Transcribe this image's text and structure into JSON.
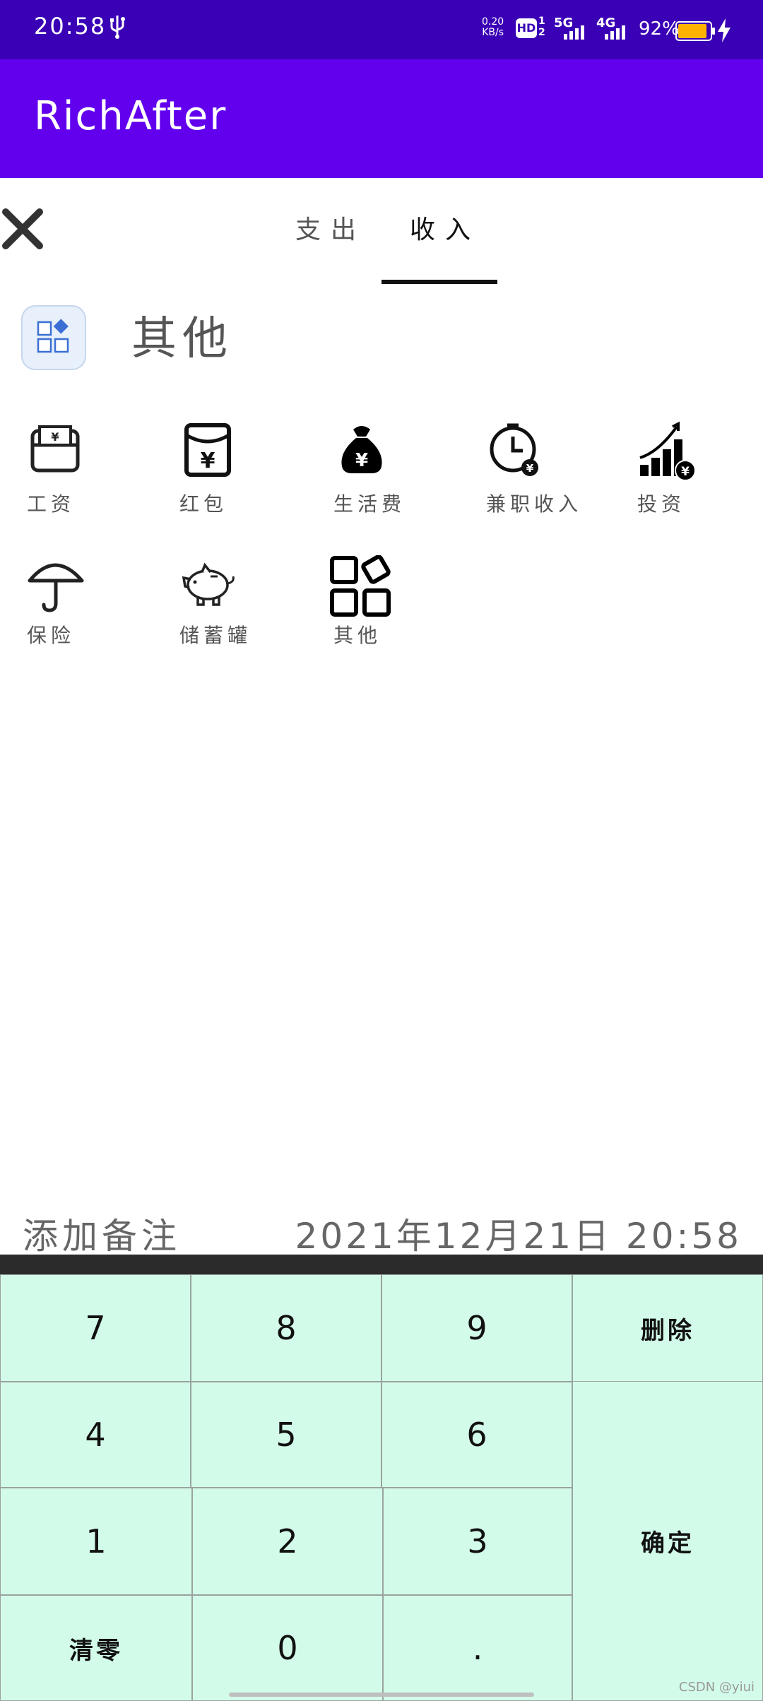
{
  "status_bar": {
    "time": "20:58",
    "net_speed_value": "0.20",
    "net_speed_unit": "KB/s",
    "hd_label": "HD",
    "sim_top": "1",
    "sim_bottom": "2",
    "network1": "5G",
    "network2": "4G",
    "battery": "92%",
    "battery_color": "#ffb300"
  },
  "app": {
    "title": "RichAfter",
    "bar_color": "#6200ee",
    "status_color": "#3a00b5"
  },
  "tabs": [
    {
      "label": "支出"
    },
    {
      "label": "收入"
    }
  ],
  "selected_category": {
    "label": "其他",
    "icon": "other-grid-icon"
  },
  "categories": [
    {
      "label": "工资",
      "icon": "wallet-yen-icon"
    },
    {
      "label": "红包",
      "icon": "red-envelope-icon"
    },
    {
      "label": "生活费",
      "icon": "money-bag-icon"
    },
    {
      "label": "兼职收入",
      "icon": "clock-yen-icon"
    },
    {
      "label": "投资",
      "icon": "growth-chart-icon"
    },
    {
      "label": "保险",
      "icon": "umbrella-icon"
    },
    {
      "label": "储蓄罐",
      "icon": "piggy-bank-icon"
    },
    {
      "label": "其他",
      "icon": "other-grid-icon"
    }
  ],
  "note_placeholder": "添加备注",
  "datetime": "2021年12月21日 20:58",
  "keypad": {
    "k7": "7",
    "k8": "8",
    "k9": "9",
    "delete": "删除",
    "k4": "4",
    "k5": "5",
    "k6": "6",
    "k1": "1",
    "k2": "2",
    "k3": "3",
    "confirm": "确定",
    "clear": "清零",
    "k0": "0",
    "dot": ".",
    "key_color": "#d3fbea"
  },
  "watermark": "CSDN @yiui"
}
